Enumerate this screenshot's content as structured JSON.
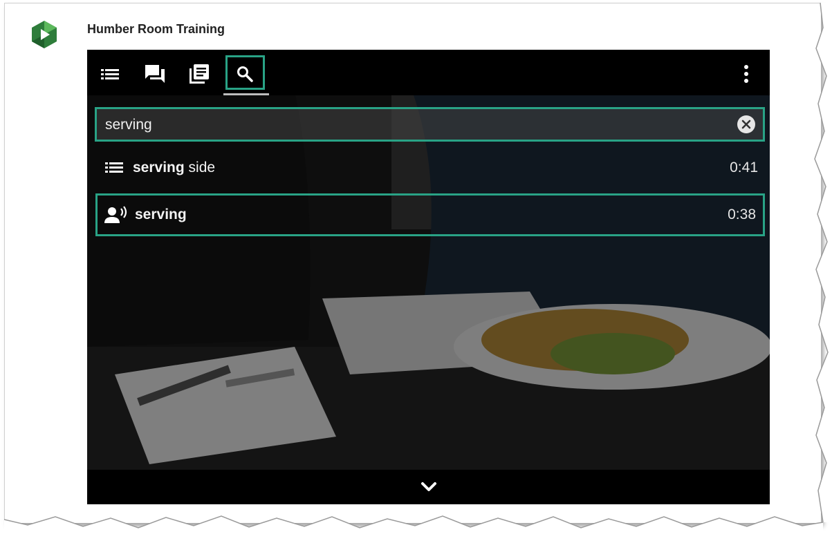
{
  "app": {
    "title": "Humber Room Training",
    "logo_icon": "kaltura-hexagon-logo"
  },
  "toolbar": {
    "tabs": [
      {
        "name": "chapters",
        "icon": "list-icon"
      },
      {
        "name": "transcript",
        "icon": "chat-icon"
      },
      {
        "name": "slides",
        "icon": "slides-icon"
      },
      {
        "name": "search",
        "icon": "search-icon",
        "active": true
      }
    ],
    "menu_icon": "more-vert-icon"
  },
  "search": {
    "value": "serving",
    "placeholder": "",
    "clear_icon": "close-circle-icon"
  },
  "results": [
    {
      "icon": "list-icon",
      "match": "serving",
      "rest": " side",
      "time": "0:41"
    },
    {
      "icon": "speaker-icon",
      "match": "serving",
      "rest": "",
      "time": "0:38",
      "selected": true
    }
  ],
  "bottom": {
    "expand_icon": "chevron-down-icon"
  },
  "colors": {
    "accent": "#29a386",
    "logo_green": "#2e7d3b",
    "logo_light": "#5cb85c"
  }
}
